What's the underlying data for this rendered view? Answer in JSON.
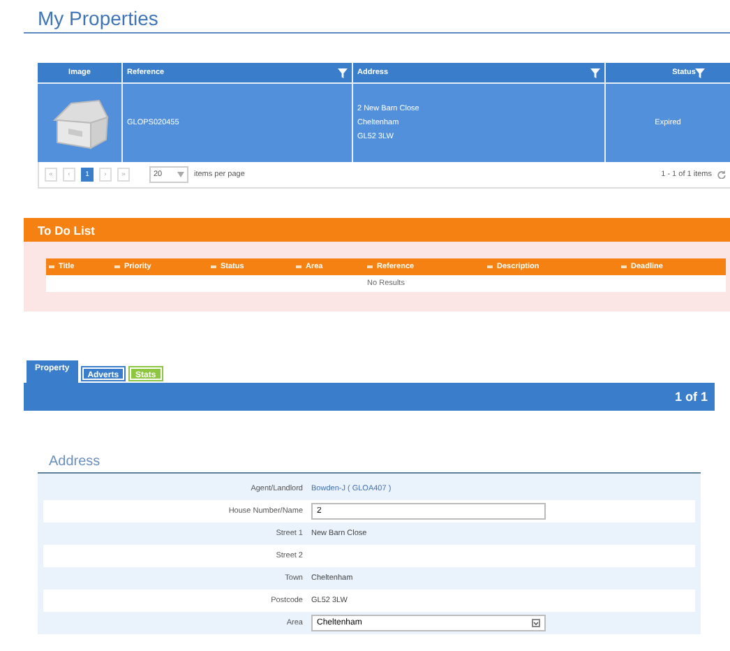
{
  "page_title": "My Properties",
  "properties_table": {
    "columns": [
      {
        "label": "Image",
        "filter": false
      },
      {
        "label": "Reference",
        "filter": true
      },
      {
        "label": "Address",
        "filter": true
      },
      {
        "label": "Status",
        "filter": true
      }
    ],
    "rows": [
      {
        "image": {
          "kind": "picture"
        },
        "reference": "GLOPS020455",
        "address": [
          "2 New Barn Close",
          "Cheltenham",
          "GL52 3LW"
        ],
        "status": "Expired",
        "selected": true
      }
    ],
    "pager": {
      "buttons": [
        {
          "label": "«",
          "selected": false
        },
        {
          "label": "‹",
          "selected": false
        },
        {
          "label": "1",
          "selected": true
        },
        {
          "label": "›",
          "selected": false
        },
        {
          "label": "»",
          "selected": false
        }
      ],
      "page_size": "20",
      "page_size_label": "items per page",
      "summary": "1 - 1 of 1 items"
    }
  },
  "todo": {
    "title": "To Do List",
    "columns": [
      "Title",
      "Priority",
      "Status",
      "Area",
      "Reference",
      "Description",
      "Deadline"
    ],
    "empty_text": "No Results"
  },
  "tabs": [
    {
      "label": "Property",
      "selected": true,
      "color": "#3a7ecb"
    },
    {
      "label": "Adverts",
      "selected": false,
      "color": "#3a7ecb"
    },
    {
      "label": "Stats",
      "selected": false,
      "color": "#8dc63f"
    }
  ],
  "record_bar": {
    "counter": "1 of 1"
  },
  "address": {
    "title": "Address",
    "fields": [
      {
        "label": "Agent/Landlord",
        "kind": "link",
        "value": "Bowden-J ( GLOA407 )"
      },
      {
        "label": "House Number/Name",
        "kind": "input",
        "value": "2"
      },
      {
        "label": "Street 1",
        "kind": "text",
        "value": "New Barn Close"
      },
      {
        "label": "Street 2",
        "kind": "text"
      },
      {
        "label": "Town",
        "kind": "text",
        "value": "Cheltenham"
      },
      {
        "label": "Postcode",
        "kind": "text",
        "value": "GL52 3LW"
      },
      {
        "label": "Area",
        "kind": "select",
        "value": "Cheltenham"
      }
    ]
  }
}
